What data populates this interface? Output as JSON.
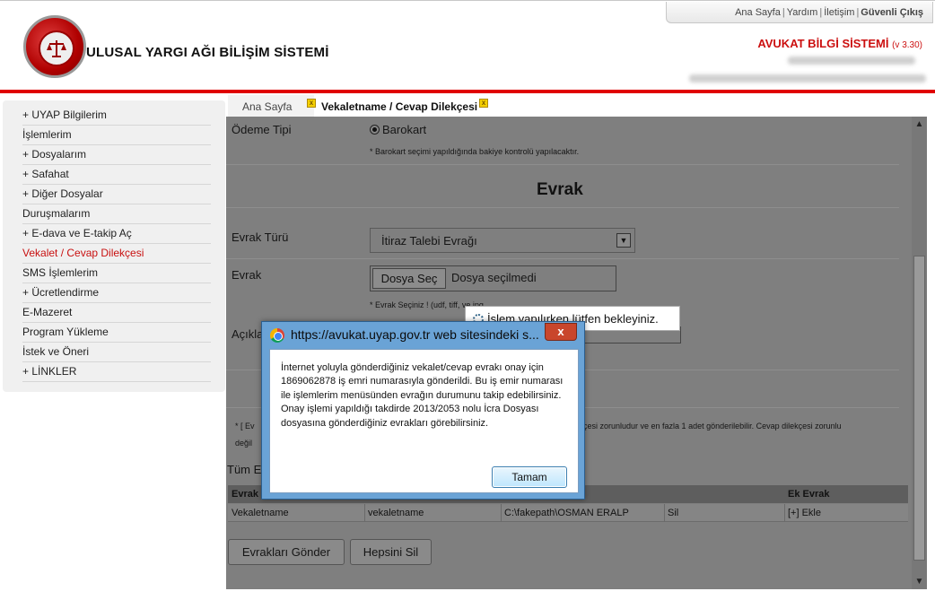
{
  "header": {
    "site_title": "ULUSAL YARGI AĞI BİLİŞİM SİSTEMİ",
    "toplinks": {
      "home": "Ana Sayfa",
      "help": "Yardım",
      "contact": "İletişim",
      "logout": "Güvenli Çıkış"
    },
    "system_name": "AVUKAT BİLGİ SİSTEMİ",
    "system_version": "(v 3.30)"
  },
  "sidebar": {
    "items": [
      {
        "label": "+ UYAP Bilgilerim"
      },
      {
        "label": "İşlemlerim"
      },
      {
        "label": "+ Dosyalarım"
      },
      {
        "label": "+ Safahat"
      },
      {
        "label": "+ Diğer Dosyalar"
      },
      {
        "label": "Duruşmalarım"
      },
      {
        "label": "+ E-dava ve E-takip Aç"
      },
      {
        "label": "Vekalet / Cevap Dilekçesi"
      },
      {
        "label": "SMS İşlemlerim"
      },
      {
        "label": "+ Ücretlendirme"
      },
      {
        "label": "E-Mazeret"
      },
      {
        "label": "Program Yükleme"
      },
      {
        "label": "İstek ve Öneri"
      },
      {
        "label": "+ LİNKLER"
      }
    ],
    "active_index": 7
  },
  "tabs": {
    "home": "Ana Sayfa",
    "active": "Vekaletname / Cevap Dilekçesi",
    "close_glyph": "x"
  },
  "form": {
    "payment_label": "Ödeme Tipi",
    "payment_option": "Barokart",
    "payment_note": "* Barokart seçimi yapıldığında bakiye kontrolü yapılacaktır.",
    "section_title": "Evrak",
    "doc_type_label": "Evrak Türü",
    "doc_type_value": "İtiraz Talebi Evrağı",
    "doc_label": "Evrak",
    "file_button": "Dosya Seç",
    "file_status": "Dosya seçilmedi",
    "file_note": "* Evrak Seçiniz ! (udf, tiff, ve jpg ",
    "desc_label": "Açıkla",
    "footnote_left": "* [ Ev",
    "footnote_left2": "değil",
    "footnote_right": "çesi zorunludur ve en fazla 1 adet gönderilebilir. Cevap dilekçesi zorunlu",
    "all_docs_label": "Tüm E"
  },
  "table": {
    "headers": [
      "Evrak",
      "",
      "",
      "",
      "Ek Evrak"
    ],
    "rows": [
      [
        "Vekaletname",
        "vekaletname",
        "C:\\fakepath\\OSMAN ERALP",
        "Sil",
        "[+] Ekle"
      ]
    ]
  },
  "buttons": {
    "send": "Evrakları Gönder",
    "delete_all": "Hepsini Sil"
  },
  "busy_text": "İşlem yapılırken lütfen bekleyiniz.",
  "dialog": {
    "title": "https://avukat.uyap.gov.tr web sitesindeki s...",
    "close": "x",
    "message": "İnternet yoluyla gönderdiğiniz vekalet/cevap evrakı onay için 1869062878 iş emri numarasıyla gönderildi. Bu iş emir numarası ile işlemlerim menüsünden evrağın durumunu takip edebilirsiniz. Onay işlemi yapıldığı takdirde 2013/2053 nolu İcra Dosyası dosyasına gönderdiğiniz evrakları görebilirsiniz.",
    "ok_label": "Tamam"
  },
  "scrollbar": {
    "up": "▲",
    "down": "▼"
  }
}
